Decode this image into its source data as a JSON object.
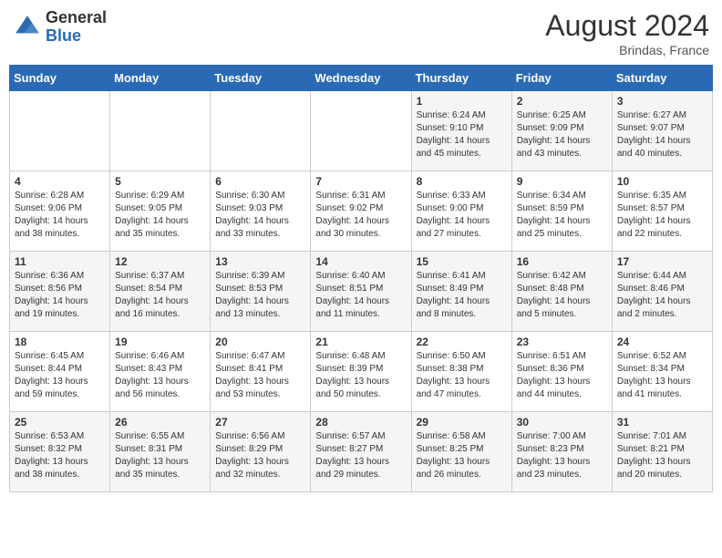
{
  "logo": {
    "general": "General",
    "blue": "Blue"
  },
  "title": {
    "month_year": "August 2024",
    "location": "Brindas, France"
  },
  "days_of_week": [
    "Sunday",
    "Monday",
    "Tuesday",
    "Wednesday",
    "Thursday",
    "Friday",
    "Saturday"
  ],
  "weeks": [
    [
      {
        "day": "",
        "info": ""
      },
      {
        "day": "",
        "info": ""
      },
      {
        "day": "",
        "info": ""
      },
      {
        "day": "",
        "info": ""
      },
      {
        "day": "1",
        "info": "Sunrise: 6:24 AM\nSunset: 9:10 PM\nDaylight: 14 hours and 45 minutes."
      },
      {
        "day": "2",
        "info": "Sunrise: 6:25 AM\nSunset: 9:09 PM\nDaylight: 14 hours and 43 minutes."
      },
      {
        "day": "3",
        "info": "Sunrise: 6:27 AM\nSunset: 9:07 PM\nDaylight: 14 hours and 40 minutes."
      }
    ],
    [
      {
        "day": "4",
        "info": "Sunrise: 6:28 AM\nSunset: 9:06 PM\nDaylight: 14 hours and 38 minutes."
      },
      {
        "day": "5",
        "info": "Sunrise: 6:29 AM\nSunset: 9:05 PM\nDaylight: 14 hours and 35 minutes."
      },
      {
        "day": "6",
        "info": "Sunrise: 6:30 AM\nSunset: 9:03 PM\nDaylight: 14 hours and 33 minutes."
      },
      {
        "day": "7",
        "info": "Sunrise: 6:31 AM\nSunset: 9:02 PM\nDaylight: 14 hours and 30 minutes."
      },
      {
        "day": "8",
        "info": "Sunrise: 6:33 AM\nSunset: 9:00 PM\nDaylight: 14 hours and 27 minutes."
      },
      {
        "day": "9",
        "info": "Sunrise: 6:34 AM\nSunset: 8:59 PM\nDaylight: 14 hours and 25 minutes."
      },
      {
        "day": "10",
        "info": "Sunrise: 6:35 AM\nSunset: 8:57 PM\nDaylight: 14 hours and 22 minutes."
      }
    ],
    [
      {
        "day": "11",
        "info": "Sunrise: 6:36 AM\nSunset: 8:56 PM\nDaylight: 14 hours and 19 minutes."
      },
      {
        "day": "12",
        "info": "Sunrise: 6:37 AM\nSunset: 8:54 PM\nDaylight: 14 hours and 16 minutes."
      },
      {
        "day": "13",
        "info": "Sunrise: 6:39 AM\nSunset: 8:53 PM\nDaylight: 14 hours and 13 minutes."
      },
      {
        "day": "14",
        "info": "Sunrise: 6:40 AM\nSunset: 8:51 PM\nDaylight: 14 hours and 11 minutes."
      },
      {
        "day": "15",
        "info": "Sunrise: 6:41 AM\nSunset: 8:49 PM\nDaylight: 14 hours and 8 minutes."
      },
      {
        "day": "16",
        "info": "Sunrise: 6:42 AM\nSunset: 8:48 PM\nDaylight: 14 hours and 5 minutes."
      },
      {
        "day": "17",
        "info": "Sunrise: 6:44 AM\nSunset: 8:46 PM\nDaylight: 14 hours and 2 minutes."
      }
    ],
    [
      {
        "day": "18",
        "info": "Sunrise: 6:45 AM\nSunset: 8:44 PM\nDaylight: 13 hours and 59 minutes."
      },
      {
        "day": "19",
        "info": "Sunrise: 6:46 AM\nSunset: 8:43 PM\nDaylight: 13 hours and 56 minutes."
      },
      {
        "day": "20",
        "info": "Sunrise: 6:47 AM\nSunset: 8:41 PM\nDaylight: 13 hours and 53 minutes."
      },
      {
        "day": "21",
        "info": "Sunrise: 6:48 AM\nSunset: 8:39 PM\nDaylight: 13 hours and 50 minutes."
      },
      {
        "day": "22",
        "info": "Sunrise: 6:50 AM\nSunset: 8:38 PM\nDaylight: 13 hours and 47 minutes."
      },
      {
        "day": "23",
        "info": "Sunrise: 6:51 AM\nSunset: 8:36 PM\nDaylight: 13 hours and 44 minutes."
      },
      {
        "day": "24",
        "info": "Sunrise: 6:52 AM\nSunset: 8:34 PM\nDaylight: 13 hours and 41 minutes."
      }
    ],
    [
      {
        "day": "25",
        "info": "Sunrise: 6:53 AM\nSunset: 8:32 PM\nDaylight: 13 hours and 38 minutes."
      },
      {
        "day": "26",
        "info": "Sunrise: 6:55 AM\nSunset: 8:31 PM\nDaylight: 13 hours and 35 minutes."
      },
      {
        "day": "27",
        "info": "Sunrise: 6:56 AM\nSunset: 8:29 PM\nDaylight: 13 hours and 32 minutes."
      },
      {
        "day": "28",
        "info": "Sunrise: 6:57 AM\nSunset: 8:27 PM\nDaylight: 13 hours and 29 minutes."
      },
      {
        "day": "29",
        "info": "Sunrise: 6:58 AM\nSunset: 8:25 PM\nDaylight: 13 hours and 26 minutes."
      },
      {
        "day": "30",
        "info": "Sunrise: 7:00 AM\nSunset: 8:23 PM\nDaylight: 13 hours and 23 minutes."
      },
      {
        "day": "31",
        "info": "Sunrise: 7:01 AM\nSunset: 8:21 PM\nDaylight: 13 hours and 20 minutes."
      }
    ]
  ]
}
